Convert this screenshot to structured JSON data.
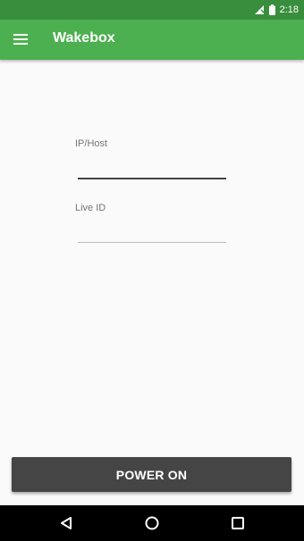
{
  "status_bar": {
    "time": "2:18",
    "icons": [
      "signal-icon",
      "battery-icon"
    ]
  },
  "app_bar": {
    "title": "Wakebox",
    "menu_icon": "hamburger-menu-icon"
  },
  "form": {
    "ip_host": {
      "label": "IP/Host",
      "value": "",
      "placeholder": ""
    },
    "live_id": {
      "label": "Live ID",
      "value": "",
      "placeholder": ""
    }
  },
  "power_button": {
    "label": "POWER ON"
  },
  "nav_bar": {
    "icons": [
      "back-icon",
      "home-icon",
      "recents-icon"
    ]
  },
  "colors": {
    "status_bar": "#388e3c",
    "app_bar": "#4caf50",
    "button": "#454545",
    "background": "#fafafa"
  }
}
